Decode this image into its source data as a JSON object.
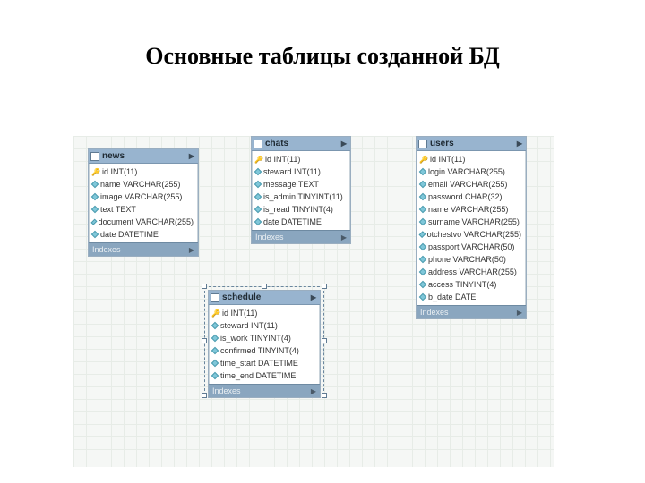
{
  "title": "Основные таблицы созданной БД",
  "indexes_label": "Indexes",
  "tables": {
    "news": {
      "name": "news",
      "columns": [
        {
          "pk": true,
          "text": "id INT(11)"
        },
        {
          "pk": false,
          "text": "name VARCHAR(255)"
        },
        {
          "pk": false,
          "text": "image VARCHAR(255)"
        },
        {
          "pk": false,
          "text": "text TEXT"
        },
        {
          "pk": false,
          "text": "document VARCHAR(255)"
        },
        {
          "pk": false,
          "text": "date DATETIME"
        }
      ]
    },
    "chats": {
      "name": "chats",
      "columns": [
        {
          "pk": true,
          "text": "id INT(11)"
        },
        {
          "pk": false,
          "text": "steward INT(11)"
        },
        {
          "pk": false,
          "text": "message TEXT"
        },
        {
          "pk": false,
          "text": "is_admin TINYINT(11)"
        },
        {
          "pk": false,
          "text": "is_read TINYINT(4)"
        },
        {
          "pk": false,
          "text": "date DATETIME"
        }
      ]
    },
    "users": {
      "name": "users",
      "columns": [
        {
          "pk": true,
          "text": "id INT(11)"
        },
        {
          "pk": false,
          "text": "login VARCHAR(255)"
        },
        {
          "pk": false,
          "text": "email VARCHAR(255)"
        },
        {
          "pk": false,
          "text": "password CHAR(32)"
        },
        {
          "pk": false,
          "text": "name VARCHAR(255)"
        },
        {
          "pk": false,
          "text": "surname VARCHAR(255)"
        },
        {
          "pk": false,
          "text": "otchestvo VARCHAR(255)"
        },
        {
          "pk": false,
          "text": "passport VARCHAR(50)"
        },
        {
          "pk": false,
          "text": "phone VARCHAR(50)"
        },
        {
          "pk": false,
          "text": "address VARCHAR(255)"
        },
        {
          "pk": false,
          "text": "access TINYINT(4)"
        },
        {
          "pk": false,
          "text": "b_date DATE"
        }
      ]
    },
    "schedule": {
      "name": "schedule",
      "columns": [
        {
          "pk": true,
          "text": "id INT(11)"
        },
        {
          "pk": false,
          "text": "steward INT(11)"
        },
        {
          "pk": false,
          "text": "is_work TINYINT(4)"
        },
        {
          "pk": false,
          "text": "confirmed TINYINT(4)"
        },
        {
          "pk": false,
          "text": "time_start DATETIME"
        },
        {
          "pk": false,
          "text": "time_end DATETIME"
        }
      ]
    }
  }
}
